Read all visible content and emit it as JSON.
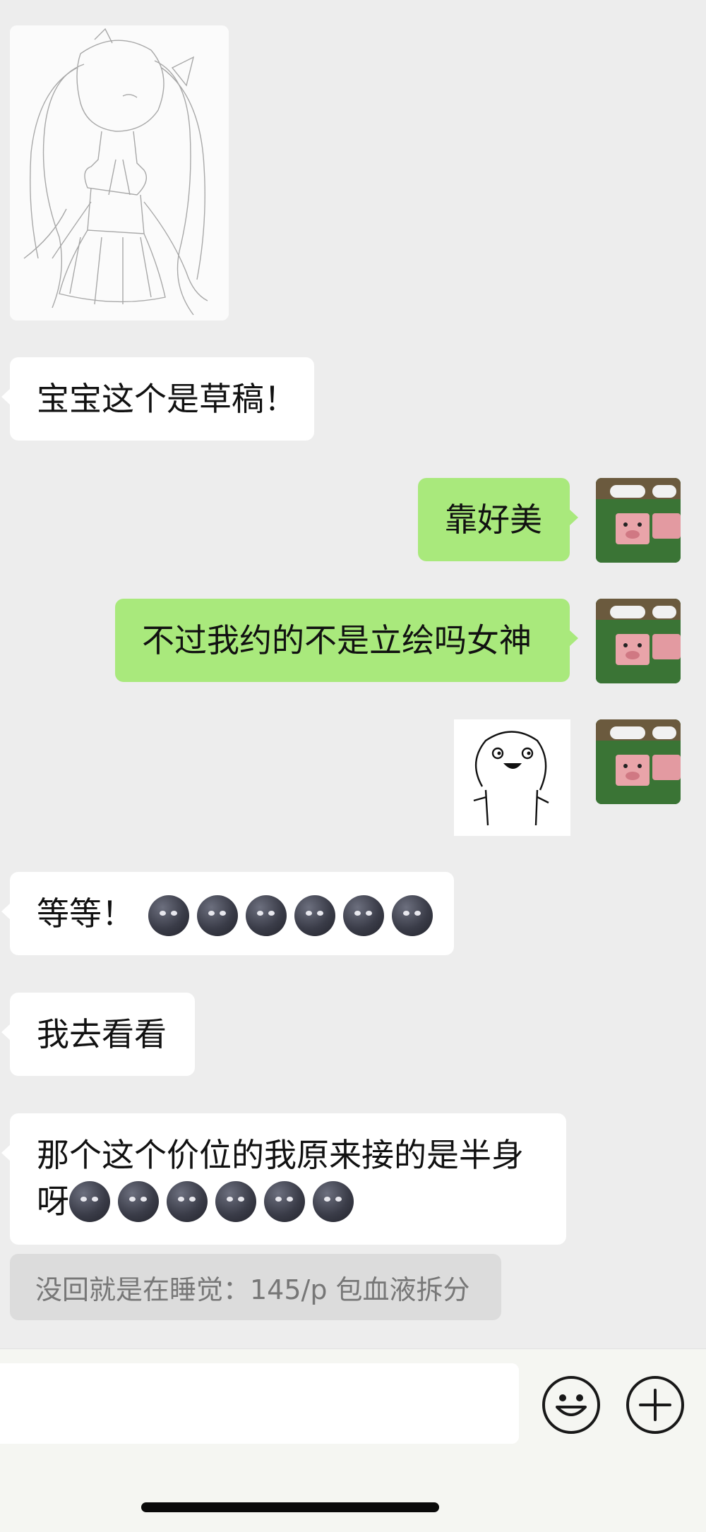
{
  "messages": {
    "draft_image": {
      "alt": "line sketch"
    },
    "m1": {
      "text": "宝宝这个是草稿！"
    },
    "m2": {
      "text": "靠好美"
    },
    "m3": {
      "text": "不过我约的不是立绘吗女神"
    },
    "m4": {
      "sticker": "smiling-blob-sticker"
    },
    "m5": {
      "text": "等等！",
      "emoji_count": 6
    },
    "m6": {
      "text": "我去看看"
    },
    "m7": {
      "text_line1": "那个这个价位的我原来接的是半身",
      "text_line2": "呀",
      "emoji_count": 6
    }
  },
  "notice": {
    "text": "没回就是在睡觉：145/p 包血液拆分"
  },
  "input_bar": {
    "placeholder": ""
  },
  "icons": {
    "emoji": "smiley-face-icon",
    "plus": "plus-circle-icon",
    "moon": "new-moon-face-icon",
    "avatar": "pig-avatar"
  },
  "colors": {
    "background": "#ededed",
    "incoming_bubble": "#ffffff",
    "outgoing_bubble": "#a9e97c",
    "notice_bubble": "#dcdcdc"
  }
}
